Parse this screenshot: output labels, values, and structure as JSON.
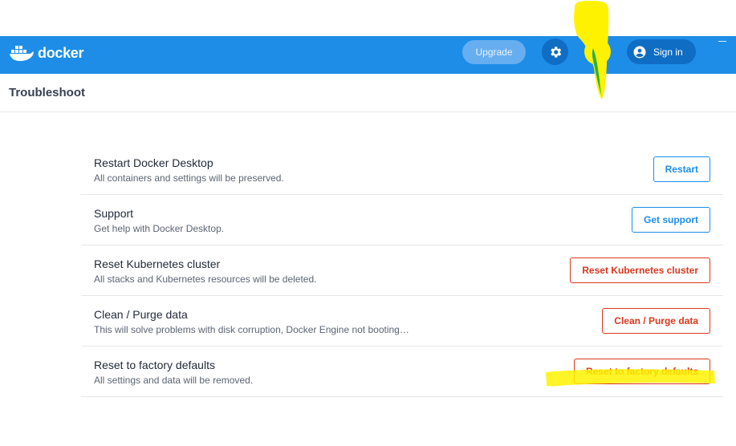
{
  "app": {
    "brand": "docker"
  },
  "header": {
    "upgrade_label": "Upgrade",
    "settings_icon": "gear-icon",
    "troubleshoot_icon": "bug-icon",
    "signin_label": "Sign in",
    "signin_icon": "account-circle-icon"
  },
  "page": {
    "title": "Troubleshoot"
  },
  "items": [
    {
      "title": "Restart Docker Desktop",
      "description": "All containers and settings will be preserved.",
      "button": "Restart",
      "variant": "primary"
    },
    {
      "title": "Support",
      "description": "Get help with Docker Desktop.",
      "button": "Get support",
      "variant": "primary"
    },
    {
      "title": "Reset Kubernetes cluster",
      "description": "All stacks and Kubernetes resources will be deleted.",
      "button": "Reset Kubernetes cluster",
      "variant": "danger"
    },
    {
      "title": "Clean / Purge data",
      "description": "This will solve problems with disk corruption, Docker Engine not booting…",
      "button": "Clean / Purge data",
      "variant": "danger"
    },
    {
      "title": "Reset to factory defaults",
      "description": "All settings and data will be removed.",
      "button": "Reset to factory defaults",
      "variant": "danger"
    }
  ],
  "colors": {
    "appbar": "#1d8de8",
    "primary": "#1d8de8",
    "danger": "#d9381e",
    "highlight": "#fff200"
  }
}
